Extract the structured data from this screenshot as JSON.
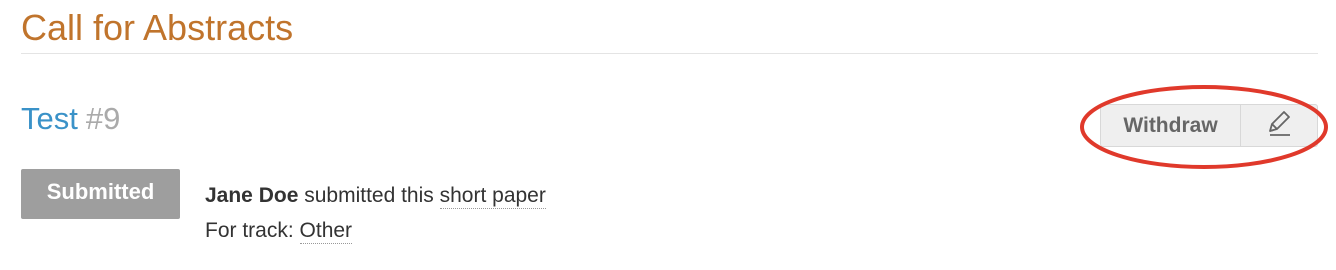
{
  "page": {
    "title": "Call for Abstracts"
  },
  "abstract": {
    "title": "Test",
    "number": "#9",
    "status": "Submitted",
    "submitter": "Jane Doe",
    "submitted_text": "submitted this",
    "contribution_type": "short paper",
    "track_label": "For track:",
    "track": "Other"
  },
  "toolbar": {
    "withdraw_label": "Withdraw",
    "edit_icon": "pencil-icon"
  },
  "colors": {
    "page_title": "#c0742c",
    "abstract_title": "#3a92c8",
    "abstract_number": "#aaaaaa",
    "status_badge": "#9e9e9e",
    "annotation": "#e0392b"
  }
}
